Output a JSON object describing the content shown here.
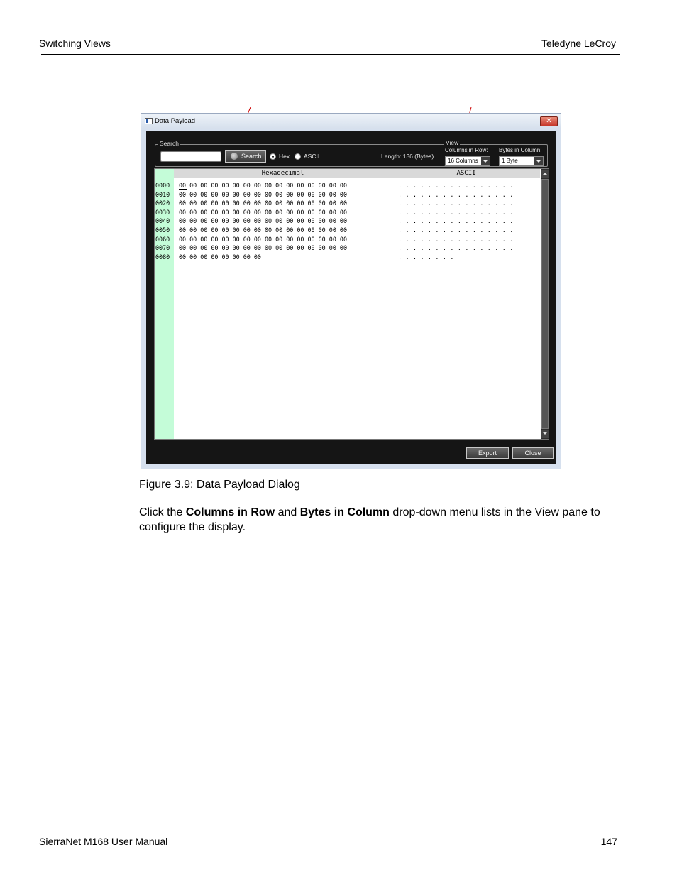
{
  "header": {
    "section": "Switching Views",
    "company": "Teledyne LeCroy"
  },
  "dialog": {
    "title": "Data Payload",
    "close_glyph": "✕",
    "search": {
      "group_label": "Search",
      "button_label": "Search",
      "radio_hex": "Hex",
      "radio_ascii": "ASCII",
      "selected_mode": "Hex",
      "length_text": "Length: 136 (Bytes)"
    },
    "view": {
      "group_label": "View",
      "columns_label": "Columns in Row:",
      "columns_value": "16 Columns",
      "bytes_label": "Bytes in Column:",
      "bytes_value": "1 Byte"
    },
    "payload": {
      "hex_header": "Hexadecimal",
      "ascii_header": "ASCII",
      "offsets": [
        "0000",
        "0010",
        "0020",
        "0030",
        "0040",
        "0050",
        "0060",
        "0070",
        "0080"
      ],
      "hex_rows": [
        "00 00 00 00 00 00 00 00 00 00 00 00 00 00 00 00",
        "00 00 00 00 00 00 00 00 00 00 00 00 00 00 00 00",
        "00 00 00 00 00 00 00 00 00 00 00 00 00 00 00 00",
        "00 00 00 00 00 00 00 00 00 00 00 00 00 00 00 00",
        "00 00 00 00 00 00 00 00 00 00 00 00 00 00 00 00",
        "00 00 00 00 00 00 00 00 00 00 00 00 00 00 00 00",
        "00 00 00 00 00 00 00 00 00 00 00 00 00 00 00 00",
        "00 00 00 00 00 00 00 00 00 00 00 00 00 00 00 00",
        "00 00 00 00 00 00 00 00"
      ],
      "ascii_rows": [
        ". . . . . . . . . . . . . . . .",
        ". . . . . . . . . . . . . . . .",
        ". . . . . . . . . . . . . . . .",
        ". . . . . . . . . . . . . . . .",
        ". . . . . . . . . . . . . . . .",
        ". . . . . . . . . . . . . . . .",
        ". . . . . . . . . . . . . . . .",
        ". . . . . . . . . . . . . . . .",
        ". . . . . . . ."
      ]
    },
    "export_label": "Export",
    "close_label": "Close"
  },
  "caption": "Figure 3.9:  Data Payload Dialog",
  "body": {
    "p1_a": "Click the ",
    "p1_b": "Columns in Row",
    "p1_c": " and ",
    "p1_d": "Bytes in Column",
    "p1_e": " drop-down menu lists in the View pane to configure the display."
  },
  "footer": {
    "manual": "SierraNet M168 User Manual",
    "page": "147"
  },
  "colors": {
    "offset_column": "#c4fcd8",
    "arrow": "#cc0000",
    "dialog_frame": "#d6e0ee",
    "client_bg": "#151515"
  }
}
